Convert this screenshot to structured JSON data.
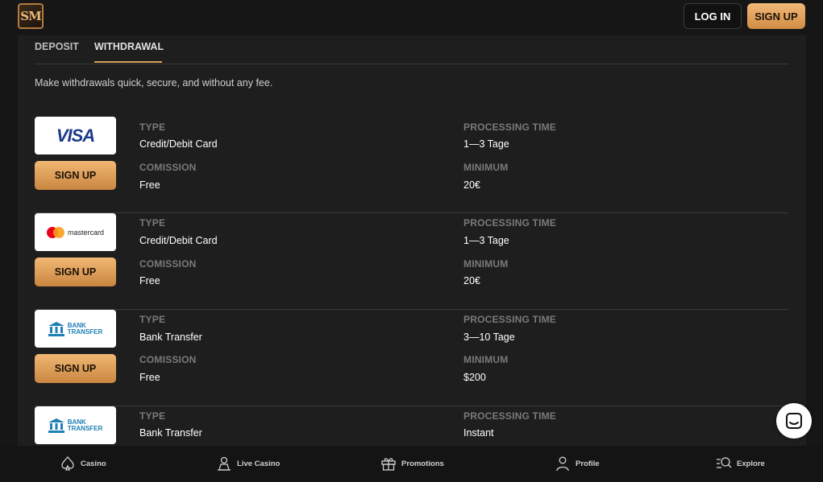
{
  "header": {
    "logo_text": "SM",
    "login_label": "LOG IN",
    "signup_label": "SIGN UP"
  },
  "tabs": [
    {
      "label": "DEPOSIT",
      "active": false
    },
    {
      "label": "WITHDRAWAL",
      "active": true
    }
  ],
  "intro": "Make withdrawals quick, secure, and without any fee.",
  "labels": {
    "type": "TYPE",
    "processing_time": "PROCESSING TIME",
    "comission": "COMISSION",
    "minimum": "MINIMUM"
  },
  "methods": [
    {
      "logo": "VISA",
      "logo_icon": "visa-logo",
      "button": "SIGN UP",
      "type": "Credit/Debit Card",
      "processing_time": "1—3 Tage",
      "comission": "Free",
      "minimum": "20€"
    },
    {
      "logo": "mastercard",
      "logo_icon": "mastercard-logo",
      "button": "SIGN UP",
      "type": "Credit/Debit Card",
      "processing_time": "1—3 Tage",
      "comission": "Free",
      "minimum": "20€"
    },
    {
      "logo": "BANK TRANSFER",
      "logo_line1": "BANK",
      "logo_line2": "TRANSFER",
      "logo_icon": "bank-transfer-logo",
      "button": "SIGN UP",
      "type": "Bank Transfer",
      "processing_time": "3—10 Tage",
      "comission": "Free",
      "minimum": "$200"
    },
    {
      "logo": "BANK TRANSFER",
      "logo_line1": "BANK",
      "logo_line2": "TRANSFER",
      "logo_icon": "bank-transfer-logo",
      "type": "Bank Transfer",
      "processing_time": "Instant"
    }
  ],
  "bottom_nav": [
    {
      "label": "Casino",
      "icon": "spade-icon"
    },
    {
      "label": "Live Casino",
      "icon": "dealer-icon"
    },
    {
      "label": "Promotions",
      "icon": "gift-icon"
    },
    {
      "label": "Profile",
      "icon": "user-icon"
    },
    {
      "label": "Explore",
      "icon": "search-list-icon"
    }
  ],
  "chat_icon": "chat-icon",
  "colors": {
    "accent": "#d9a05c",
    "button_gradient_top": "#f1b874",
    "button_gradient_bottom": "#c98640",
    "background": "#161616",
    "panel": "#1e1e1e"
  }
}
